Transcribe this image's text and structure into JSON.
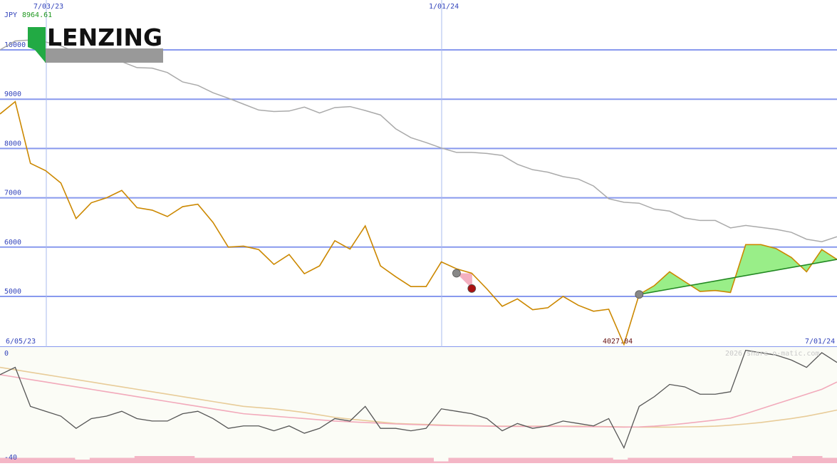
{
  "currency": "JPY",
  "last_value": "8964.61",
  "logo_text": "LENZING",
  "watermark": "2026 share-o-matic.com",
  "date_labels": {
    "top_left": "7/03/23",
    "top_mid": "1/01/24",
    "bottom_left": "6/05/23",
    "bottom_right": "7/01/24"
  },
  "min_label": "4027.04",
  "osc_labels": {
    "top": "0",
    "bottom": "-40"
  },
  "colors": {
    "price": "#cc8800",
    "ma": "#aaaaaa",
    "fill": "#99ee88",
    "trend": "#228822",
    "grid": "#8899ee",
    "osc": "#555555",
    "osc_ma1": "#f2aabb",
    "osc_ma2": "#e8cc99",
    "volume": "#f4b6c6"
  },
  "chart_data": [
    {
      "type": "line",
      "ylim": [
        3950,
        10600
      ],
      "y_ticks": [
        5000,
        6000,
        7000,
        8000,
        9000,
        10000
      ],
      "series": [
        {
          "values": [
            8700,
            8950,
            7700,
            7550,
            7300,
            6580,
            6900,
            7000,
            7150,
            6800,
            6750,
            6620,
            6820,
            6870,
            6500,
            6000,
            6020,
            5950,
            5650,
            5850,
            5460,
            5620,
            6130,
            5960,
            6430,
            5620,
            5400,
            5200,
            5200,
            5700,
            5560,
            5470,
            5150,
            4800,
            4950,
            4730,
            4770,
            5000,
            4820,
            4700,
            4740,
            4027,
            5040,
            5220,
            5500,
            5300,
            5100,
            5120,
            5080,
            6050,
            6050,
            5970,
            5790,
            5500,
            5950,
            5750
          ]
        },
        {
          "values": [
            10000,
            10180,
            10200,
            10160,
            10080,
            9950,
            9850,
            9820,
            9760,
            9640,
            9630,
            9540,
            9350,
            9280,
            9130,
            9020,
            8900,
            8780,
            8750,
            8760,
            8840,
            8720,
            8830,
            8850,
            8770,
            8680,
            8400,
            8220,
            8120,
            8010,
            7920,
            7920,
            7900,
            7860,
            7680,
            7570,
            7520,
            7430,
            7380,
            7240,
            6980,
            6910,
            6890,
            6770,
            6730,
            6590,
            6540,
            6540,
            6390,
            6440,
            6400,
            6360,
            6300,
            6160,
            6110,
            6210
          ]
        }
      ],
      "signals": [
        {
          "date": "2023-12-11",
          "value": 5470,
          "kind": "gray"
        },
        {
          "date": "2023-12-25",
          "value": 5160,
          "kind": "red"
        },
        {
          "date": "2024-04-08",
          "value": 5040,
          "kind": "gray"
        }
      ],
      "trend": {
        "from": 5040,
        "to": 5750
      }
    },
    {
      "type": "line",
      "ylim": [
        -40,
        0
      ],
      "series": [
        {
          "values": [
            -9,
            -6,
            -22,
            -24,
            -26,
            -31,
            -27,
            -26,
            -24,
            -27,
            -28,
            -28,
            -25,
            -24,
            -27,
            -31,
            -30,
            -30,
            -32,
            -30,
            -33,
            -31,
            -27,
            -28,
            -22,
            -31,
            -31,
            -32,
            -31,
            -23,
            -24,
            -25,
            -27,
            -32,
            -29,
            -31,
            -30,
            -28,
            -29,
            -30,
            -27,
            -39,
            -22,
            -18,
            -13,
            -14,
            -17,
            -17,
            -16,
            1,
            0,
            -1,
            -3,
            -6,
            0,
            -4
          ]
        },
        {
          "values": [
            -9,
            -10,
            -11,
            -12,
            -13,
            -14,
            -15,
            -16,
            -17,
            -18,
            -19,
            -20,
            -21,
            -22,
            -23,
            -24,
            -25,
            -25.5,
            -26,
            -26.5,
            -27,
            -27.5,
            -28,
            -28.3,
            -28.6,
            -28.9,
            -29.2,
            -29.4,
            -29.6,
            -29.8,
            -29.9,
            -30,
            -30.1,
            -30.2,
            -30.2,
            -30.2,
            -30.2,
            -30.2,
            -30.3,
            -30.3,
            -30.4,
            -30.5,
            -30.4,
            -30.1,
            -29.6,
            -29,
            -28.3,
            -27.6,
            -26.8,
            -25,
            -23,
            -21,
            -19,
            -17,
            -15,
            -12
          ]
        },
        {
          "values": [
            -6,
            -7,
            -8,
            -9,
            -10,
            -11,
            -12,
            -13,
            -14,
            -15,
            -16,
            -17,
            -18,
            -19,
            -20,
            -21,
            -22,
            -22.5,
            -23,
            -23.7,
            -24.5,
            -25.5,
            -26.5,
            -27.2,
            -27.8,
            -28.4,
            -29,
            -29.2,
            -29.4,
            -29.6,
            -29.8,
            -29.9,
            -30,
            -30.1,
            -30.1,
            -30.1,
            -30.1,
            -30.1,
            -30.1,
            -30.2,
            -30.3,
            -30.4,
            -30.5,
            -30.5,
            -30.5,
            -30.4,
            -30.3,
            -30.1,
            -29.7,
            -29.2,
            -28.6,
            -27.8,
            -27,
            -26,
            -24.8,
            -23.5
          ]
        }
      ],
      "volume": [
        3,
        3,
        3,
        3,
        3,
        2,
        3,
        3,
        3,
        4,
        4,
        4,
        4,
        3,
        3,
        3,
        3,
        3,
        3,
        3,
        3,
        3,
        3,
        3,
        3,
        3,
        3,
        3,
        3,
        1,
        3,
        3,
        3,
        3,
        3,
        3,
        3,
        3,
        3,
        3,
        3,
        2,
        3,
        3,
        3,
        3,
        3,
        3,
        3,
        3,
        3,
        3,
        3,
        4,
        4,
        3
      ]
    }
  ]
}
